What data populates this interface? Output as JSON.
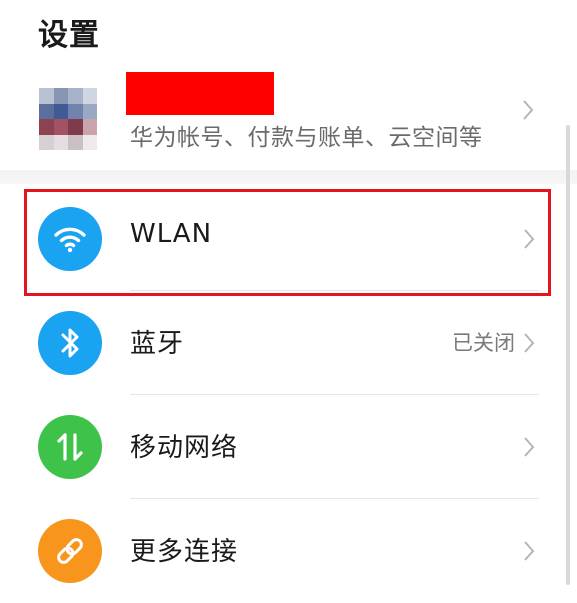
{
  "header": {
    "title": "设置"
  },
  "account": {
    "subtitle": "华为帐号、付款与账单、云空间等"
  },
  "settings": [
    {
      "label": "WLAN",
      "status": "",
      "icon": "wifi-icon",
      "color": "#1aa3f0"
    },
    {
      "label": "蓝牙",
      "status": "已关闭",
      "icon": "bluetooth-icon",
      "color": "#1aa3f0"
    },
    {
      "label": "移动网络",
      "status": "",
      "icon": "mobile-data-icon",
      "color": "#3fc24a"
    },
    {
      "label": "更多连接",
      "status": "",
      "icon": "link-icon",
      "color": "#f7951d"
    }
  ],
  "colors": {
    "highlight": "#e3151c",
    "redaction": "#ff0000"
  }
}
